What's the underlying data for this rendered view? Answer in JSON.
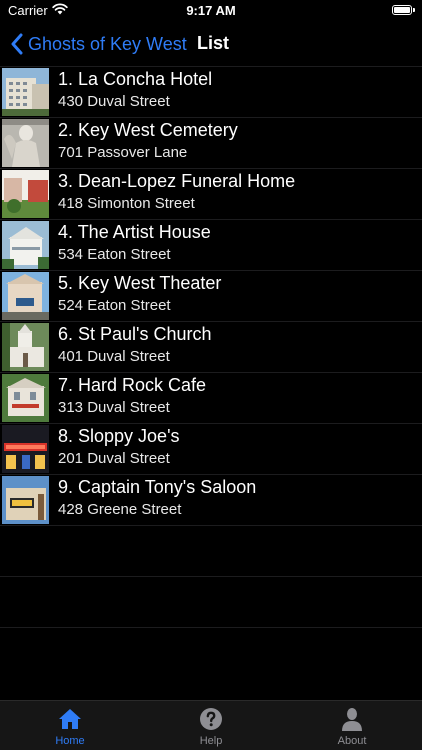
{
  "status_bar": {
    "carrier": "Carrier",
    "time": "9:17 AM"
  },
  "nav": {
    "back_label": "Ghosts of Key West",
    "title": "List"
  },
  "list": {
    "items": [
      {
        "title": "1. La Concha Hotel",
        "address": "430 Duval Street"
      },
      {
        "title": "2. Key West Cemetery",
        "address": "701 Passover Lane"
      },
      {
        "title": "3. Dean-Lopez Funeral Home",
        "address": "418 Simonton Street"
      },
      {
        "title": "4. The Artist House",
        "address": "534 Eaton Street"
      },
      {
        "title": "5. Key West Theater",
        "address": "524 Eaton Street"
      },
      {
        "title": "6. St Paul's Church",
        "address": "401 Duval Street"
      },
      {
        "title": "7. Hard Rock Cafe",
        "address": "313 Duval Street"
      },
      {
        "title": "8. Sloppy Joe's",
        "address": "201 Duval Street"
      },
      {
        "title": "9. Captain Tony's Saloon",
        "address": "428 Greene Street"
      }
    ]
  },
  "tab_bar": {
    "home": "Home",
    "help": "Help",
    "about": "About",
    "active_color": "#2f7cf6",
    "inactive_color": "#8e8e93"
  }
}
